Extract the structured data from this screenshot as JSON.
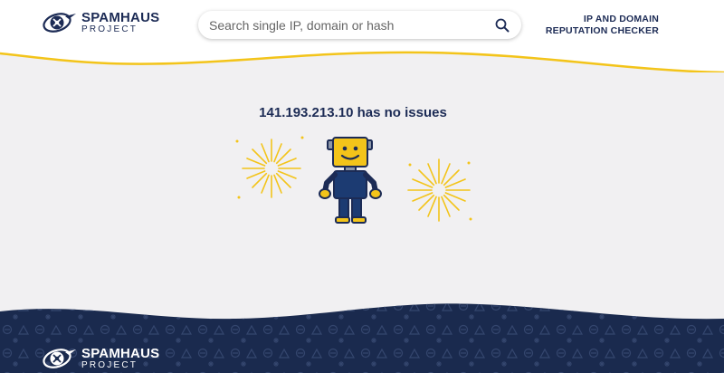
{
  "brand": {
    "name": "SPAMHAUS",
    "sub": "PROJECT"
  },
  "search": {
    "placeholder": "Search single IP, domain or hash",
    "icon": "search-icon"
  },
  "tagline": {
    "line1": "IP AND DOMAIN",
    "line2": "REPUTATION CHECKER"
  },
  "result": {
    "message": "141.193.213.10 has no issues"
  },
  "footer": {
    "brand_name": "SPAMHAUS",
    "brand_sub": "PROJECT"
  },
  "colors": {
    "navy": "#1c2b55",
    "gold": "#f3c41a",
    "background": "#f1f0f2",
    "footer": "#1a2a4e"
  }
}
